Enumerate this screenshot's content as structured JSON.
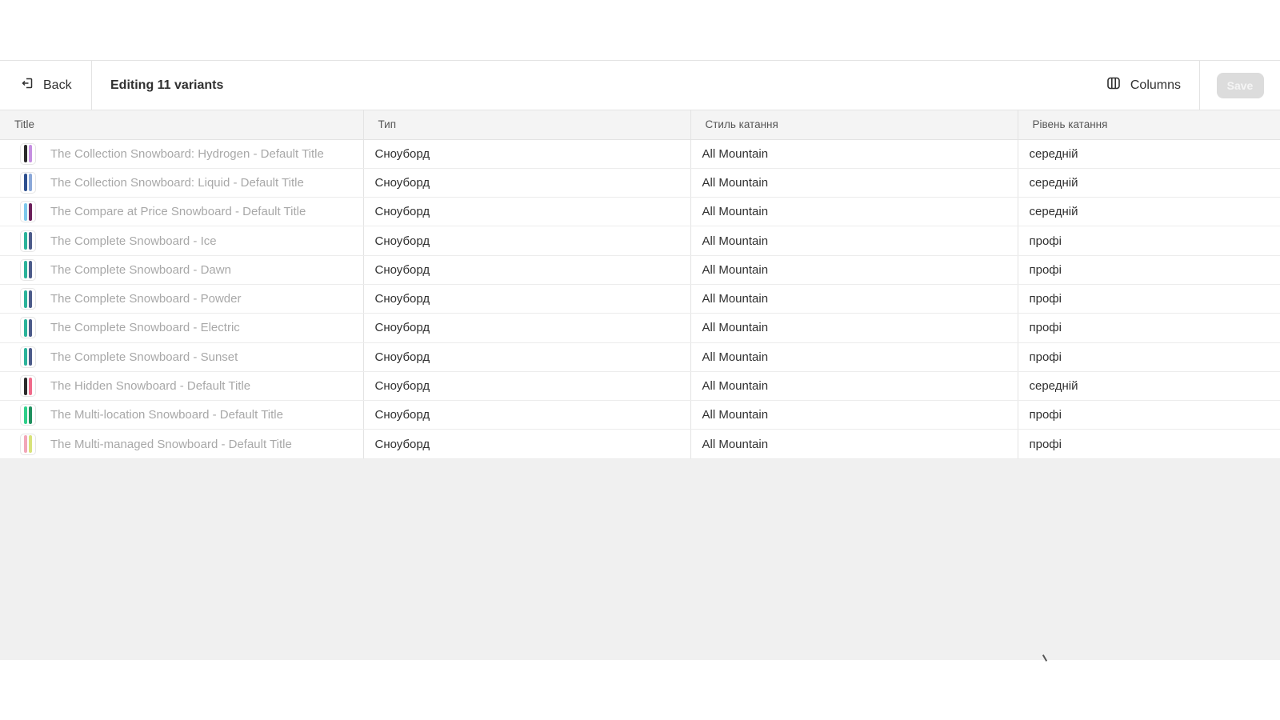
{
  "toolbar": {
    "back_label": "Back",
    "title": "Editing 11 variants",
    "columns_label": "Columns",
    "save_label": "Save"
  },
  "table": {
    "headers": [
      "Title",
      "Тип",
      "Стиль катання",
      "Рівень катання"
    ],
    "rows": [
      {
        "title": "The Collection Snowboard: Hydrogen - Default Title",
        "type": "Сноуборд",
        "style": "All Mountain",
        "level": "середній",
        "colors": [
          "#2b2b2b",
          "#c58ee0"
        ]
      },
      {
        "title": "The Collection Snowboard: Liquid - Default Title",
        "type": "Сноуборд",
        "style": "All Mountain",
        "level": "середній",
        "colors": [
          "#2d4f8e",
          "#8aa7d8"
        ]
      },
      {
        "title": "The Compare at Price Snowboard - Default Title",
        "type": "Сноуборд",
        "style": "All Mountain",
        "level": "середній",
        "colors": [
          "#7ec8ec",
          "#6b1f5a"
        ]
      },
      {
        "title": "The Complete Snowboard - Ice",
        "type": "Сноуборд",
        "style": "All Mountain",
        "level": "профі",
        "colors": [
          "#2bb39a",
          "#4c5b8a"
        ]
      },
      {
        "title": "The Complete Snowboard - Dawn",
        "type": "Сноуборд",
        "style": "All Mountain",
        "level": "профі",
        "colors": [
          "#2bb39a",
          "#4c5b8a"
        ]
      },
      {
        "title": "The Complete Snowboard - Powder",
        "type": "Сноуборд",
        "style": "All Mountain",
        "level": "профі",
        "colors": [
          "#2bb39a",
          "#4c5b8a"
        ]
      },
      {
        "title": "The Complete Snowboard - Electric",
        "type": "Сноуборд",
        "style": "All Mountain",
        "level": "профі",
        "colors": [
          "#2bb39a",
          "#4c5b8a"
        ]
      },
      {
        "title": "The Complete Snowboard - Sunset",
        "type": "Сноуборд",
        "style": "All Mountain",
        "level": "профі",
        "colors": [
          "#2bb39a",
          "#4c5b8a"
        ]
      },
      {
        "title": "The Hidden Snowboard - Default Title",
        "type": "Сноуборд",
        "style": "All Mountain",
        "level": "середній",
        "colors": [
          "#2b2b2b",
          "#f06a8a"
        ]
      },
      {
        "title": "The Multi-location Snowboard - Default Title",
        "type": "Сноуборд",
        "style": "All Mountain",
        "level": "профі",
        "colors": [
          "#2fcf8a",
          "#1f8f5e"
        ]
      },
      {
        "title": "The Multi-managed Snowboard - Default Title",
        "type": "Сноуборд",
        "style": "All Mountain",
        "level": "профі",
        "colors": [
          "#f2a6b8",
          "#d8e27a"
        ]
      }
    ]
  }
}
